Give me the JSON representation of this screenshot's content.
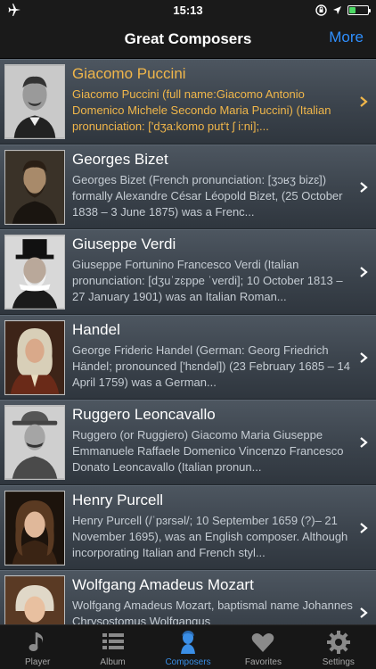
{
  "status_bar": {
    "time": "15:13"
  },
  "nav": {
    "title": "Great Composers",
    "more_label": "More"
  },
  "composers": [
    {
      "name": "Giacomo Puccini",
      "description": "Giacomo Puccini (full name:Giacomo Antonio Domenico Michele Secondo Maria Puccini) (Italian pronunciation: ['dʒa:komo put't ʃ i:ni];..."
    },
    {
      "name": "Georges Bizet",
      "description": "Georges Bizet (French pronunciation: [ʒɔʁʒ bizɛ]) formally Alexandre César Léopold Bizet, (25 October 1838 – 3 June 1875) was a Frenc..."
    },
    {
      "name": "Giuseppe Verdi",
      "description": "Giuseppe Fortunino Francesco Verdi (Italian pronunciation: [dʒuˈzɛppe ˈverdi]; 10 October 1813 – 27 January 1901) was an Italian Roman..."
    },
    {
      "name": "Handel",
      "description": "George Frideric Handel (German: Georg Friedrich Händel; pronounced ['hɛndəl]) (23 February 1685 – 14 April 1759) was a German..."
    },
    {
      "name": "Ruggero Leoncavallo",
      "description": "Ruggero (or Ruggiero) Giacomo Maria Giuseppe Emmanuele Raffaele Domenico Vincenzo Francesco Donato Leoncavallo (Italian pronun..."
    },
    {
      "name": "Henry Purcell",
      "description": "Henry Purcell (/ˈpɜrsəl/; 10 September 1659 (?)– 21 November 1695), was an English composer. Although incorporating Italian and French styl..."
    },
    {
      "name": "Wolfgang Amadeus Mozart",
      "description": "Wolfgang Amadeus Mozart, baptismal name Johannes Chrysostomus Wolfgangus"
    }
  ],
  "tabs": [
    {
      "label": "Player",
      "icon": "music-note-icon"
    },
    {
      "label": "Album",
      "icon": "list-icon"
    },
    {
      "label": "Composers",
      "icon": "composer-bust-icon"
    },
    {
      "label": "Favorites",
      "icon": "heart-icon"
    },
    {
      "label": "Settings",
      "icon": "gear-icon"
    }
  ],
  "colors": {
    "accent": "#3a8ee6",
    "selected_text": "#f0b64a"
  }
}
